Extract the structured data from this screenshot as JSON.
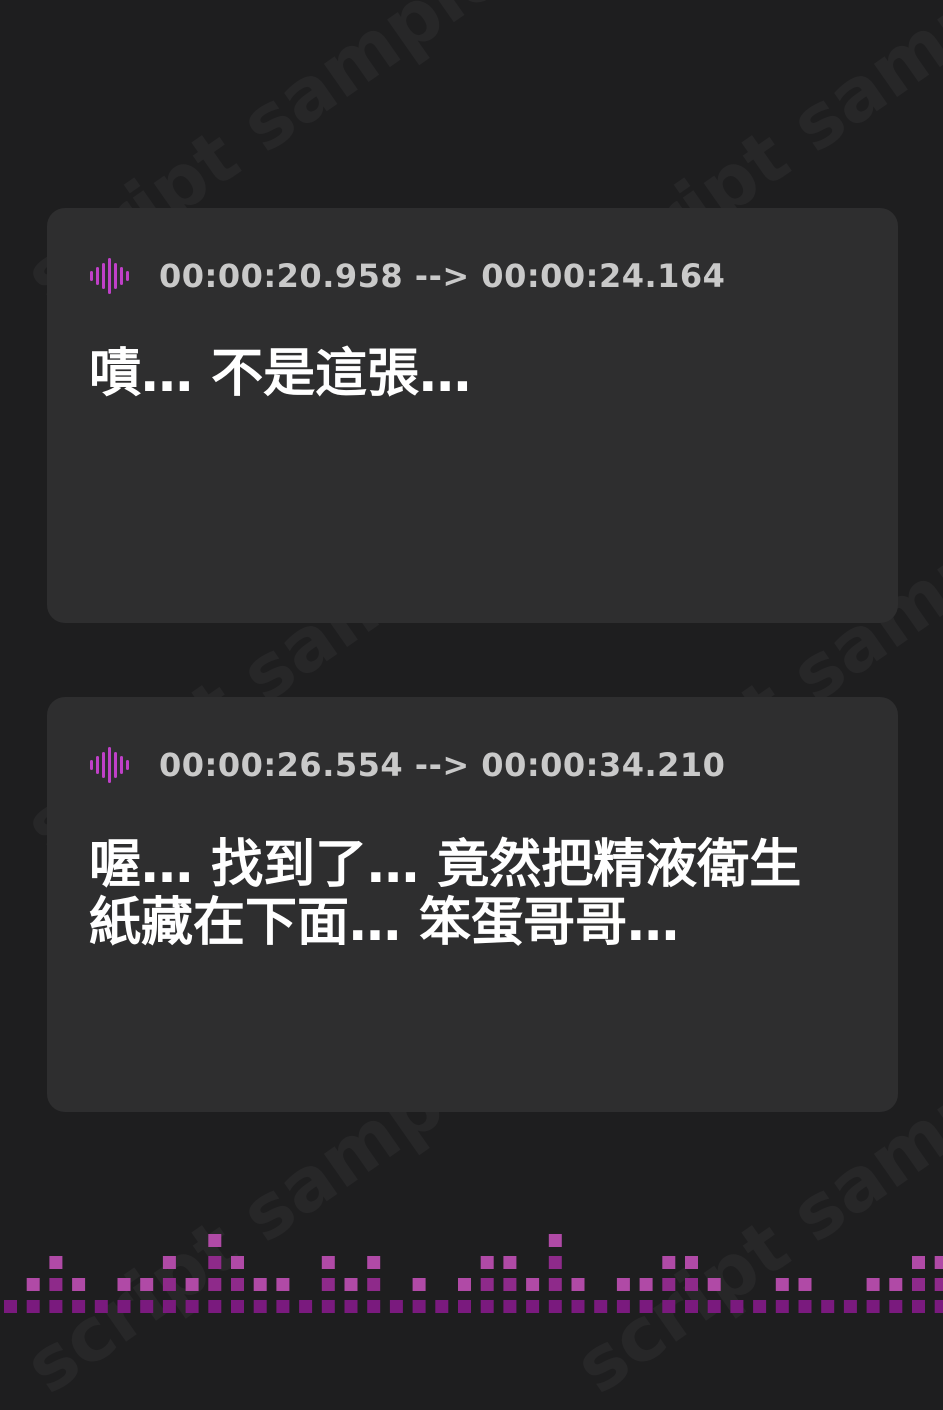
{
  "watermark_text": "script sample",
  "accent_color": "#c040c8",
  "cards": [
    {
      "icon": "audio-wave-icon",
      "timestamp": "00:00:20.958 --> 00:00:24.164",
      "lines": [
        "嘖… 不是這張…"
      ]
    },
    {
      "icon": "audio-wave-icon",
      "timestamp": "00:00:26.554 --> 00:00:34.210",
      "lines": [
        "喔… 找到了… 竟然把精液衛生",
        "紙藏在下面… 笨蛋哥哥…"
      ]
    }
  ]
}
